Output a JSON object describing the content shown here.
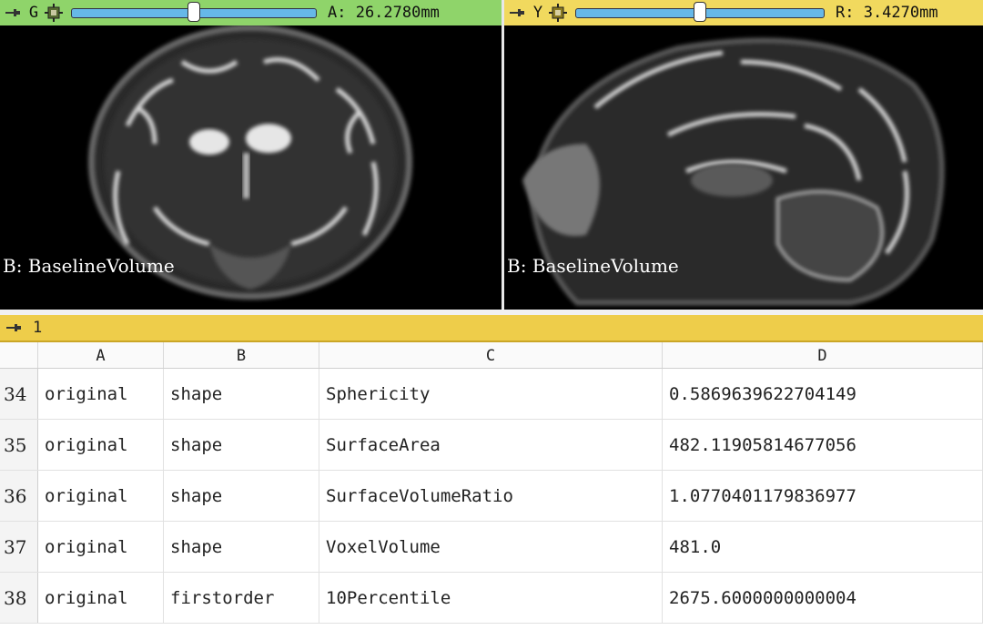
{
  "views": {
    "left": {
      "letter": "G",
      "offset_text": "A: 26.2780mm",
      "slider_fraction": 0.5,
      "bar_color": "#8fd46a",
      "label": "B: BaselineVolume"
    },
    "right": {
      "letter": "Y",
      "offset_text": "R: 3.4270mm",
      "slider_fraction": 0.5,
      "bar_color": "#f1d95e",
      "label": "B: BaselineVolume"
    }
  },
  "icons": {
    "pin": "pin-icon",
    "fit": "fit-to-window-icon"
  },
  "table_view": {
    "layout_number": "1",
    "bar_color": "#eecd4a",
    "columns": [
      "A",
      "B",
      "C",
      "D"
    ],
    "rows": [
      {
        "num": "34",
        "a": "original",
        "b": "shape",
        "c": "Sphericity",
        "d": "0.5869639622704149"
      },
      {
        "num": "35",
        "a": "original",
        "b": "shape",
        "c": "SurfaceArea",
        "d": "482.11905814677056"
      },
      {
        "num": "36",
        "a": "original",
        "b": "shape",
        "c": "SurfaceVolumeRatio",
        "d": "1.0770401179836977"
      },
      {
        "num": "37",
        "a": "original",
        "b": "shape",
        "c": "VoxelVolume",
        "d": "481.0"
      },
      {
        "num": "38",
        "a": "original",
        "b": "firstorder",
        "c": "10Percentile",
        "d": "2675.6000000000004"
      }
    ]
  }
}
